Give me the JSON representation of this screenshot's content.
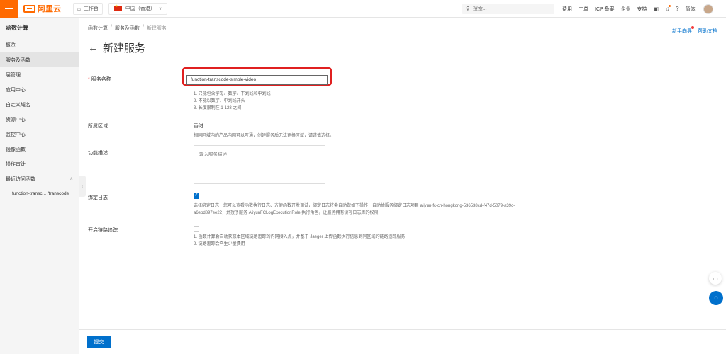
{
  "topbar": {
    "logo_text": "阿里云",
    "workbench_label": "工作台",
    "region_label": "中国（香港）",
    "search_placeholder": "搜索...",
    "nav": [
      "费用",
      "工单",
      "ICP 备案",
      "企业",
      "支持"
    ],
    "language": "简体",
    "accent": "#ff6a00"
  },
  "sidebar": {
    "title": "函数计算",
    "items": [
      {
        "label": "概览",
        "active": false
      },
      {
        "label": "服务及函数",
        "active": true
      },
      {
        "label": "层管理",
        "active": false
      },
      {
        "label": "应用中心",
        "active": false
      },
      {
        "label": "自定义域名",
        "active": false
      },
      {
        "label": "资源中心",
        "active": false
      },
      {
        "label": "监控中心",
        "active": false
      },
      {
        "label": "镜像函数",
        "active": false
      },
      {
        "label": "操作审计",
        "active": false
      }
    ],
    "recent_label": "最近访问函数",
    "recent_items": [
      "function-transc... /transcode"
    ]
  },
  "main": {
    "breadcrumb": [
      "函数计算",
      "服务及函数",
      "新建服务"
    ],
    "links": {
      "newbie": "新手向导",
      "help": "帮助文档"
    },
    "title": "新建服务",
    "service_name": {
      "label": "服务名称",
      "value": "function-transcode-simple-video",
      "hints": [
        "1. 只能包含字母、数字、下划线和中划线",
        "2. 不能以数字、中划线开头",
        "3. 长度限制在 1-128 之间"
      ]
    },
    "region": {
      "label": "所属区域",
      "value": "香港",
      "hint": "相同区域内的产品内网可以互通，创建服务后无法更换区域，请谨慎选择。"
    },
    "description": {
      "label": "功能描述",
      "placeholder": "输入服务描述"
    },
    "log": {
      "label": "绑定日志",
      "checked": true,
      "hint_line1": "选择绑定日志，您可以查看函数执行日志、方便函数开发调试，绑定日志将会自动做如下操作：自动给服务绑定日志项目 aliyun-fc-cn-hongkong-536538cd-f47d-5079-a39c-",
      "hint_line2": "a6ebd897ee22，并授予服务 AliyunFCLogExecutionRole 执行角色，让服务拥有读写日志库的权限"
    },
    "tracing": {
      "label": "开启链路追踪",
      "checked": false,
      "hints": [
        "1. 函数计算会自动获取本区域链路追踪的内网接入点，并基于 Jaeger 上传函数执行信息到同区域的链路追踪服务",
        "2. 链路追踪会产生少量费用"
      ]
    },
    "submit_label": "提交"
  }
}
